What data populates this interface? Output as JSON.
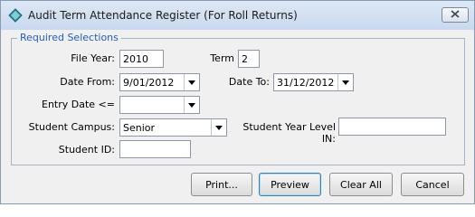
{
  "window": {
    "title": "Audit Term Attendance Register (For Roll Returns)"
  },
  "group": {
    "legend": "Required Selections"
  },
  "fields": {
    "file_year": {
      "label": "File Year:",
      "value": "2010"
    },
    "term": {
      "label": "Term",
      "value": "2"
    },
    "date_from": {
      "label": "Date From:",
      "value": "9/01/2012"
    },
    "date_to": {
      "label": "Date To:",
      "value": "31/12/2012"
    },
    "entry_date": {
      "label": "Entry Date <=",
      "value": ""
    },
    "student_campus": {
      "label": "Student Campus:",
      "value": "Senior"
    },
    "student_year_level": {
      "label": "Student Year Level IN:",
      "value": ""
    },
    "student_id": {
      "label": "Student ID:",
      "value": ""
    }
  },
  "buttons": {
    "print": "Print...",
    "preview": "Preview",
    "clear_all": "Clear All",
    "cancel": "Cancel"
  },
  "colors": {
    "legend": "#1f5fbf",
    "titlebar": "#c9d9ee"
  },
  "icons": {
    "app": "diamond-app-icon",
    "close": "close-icon",
    "dropdown": "chevron-down-icon"
  }
}
